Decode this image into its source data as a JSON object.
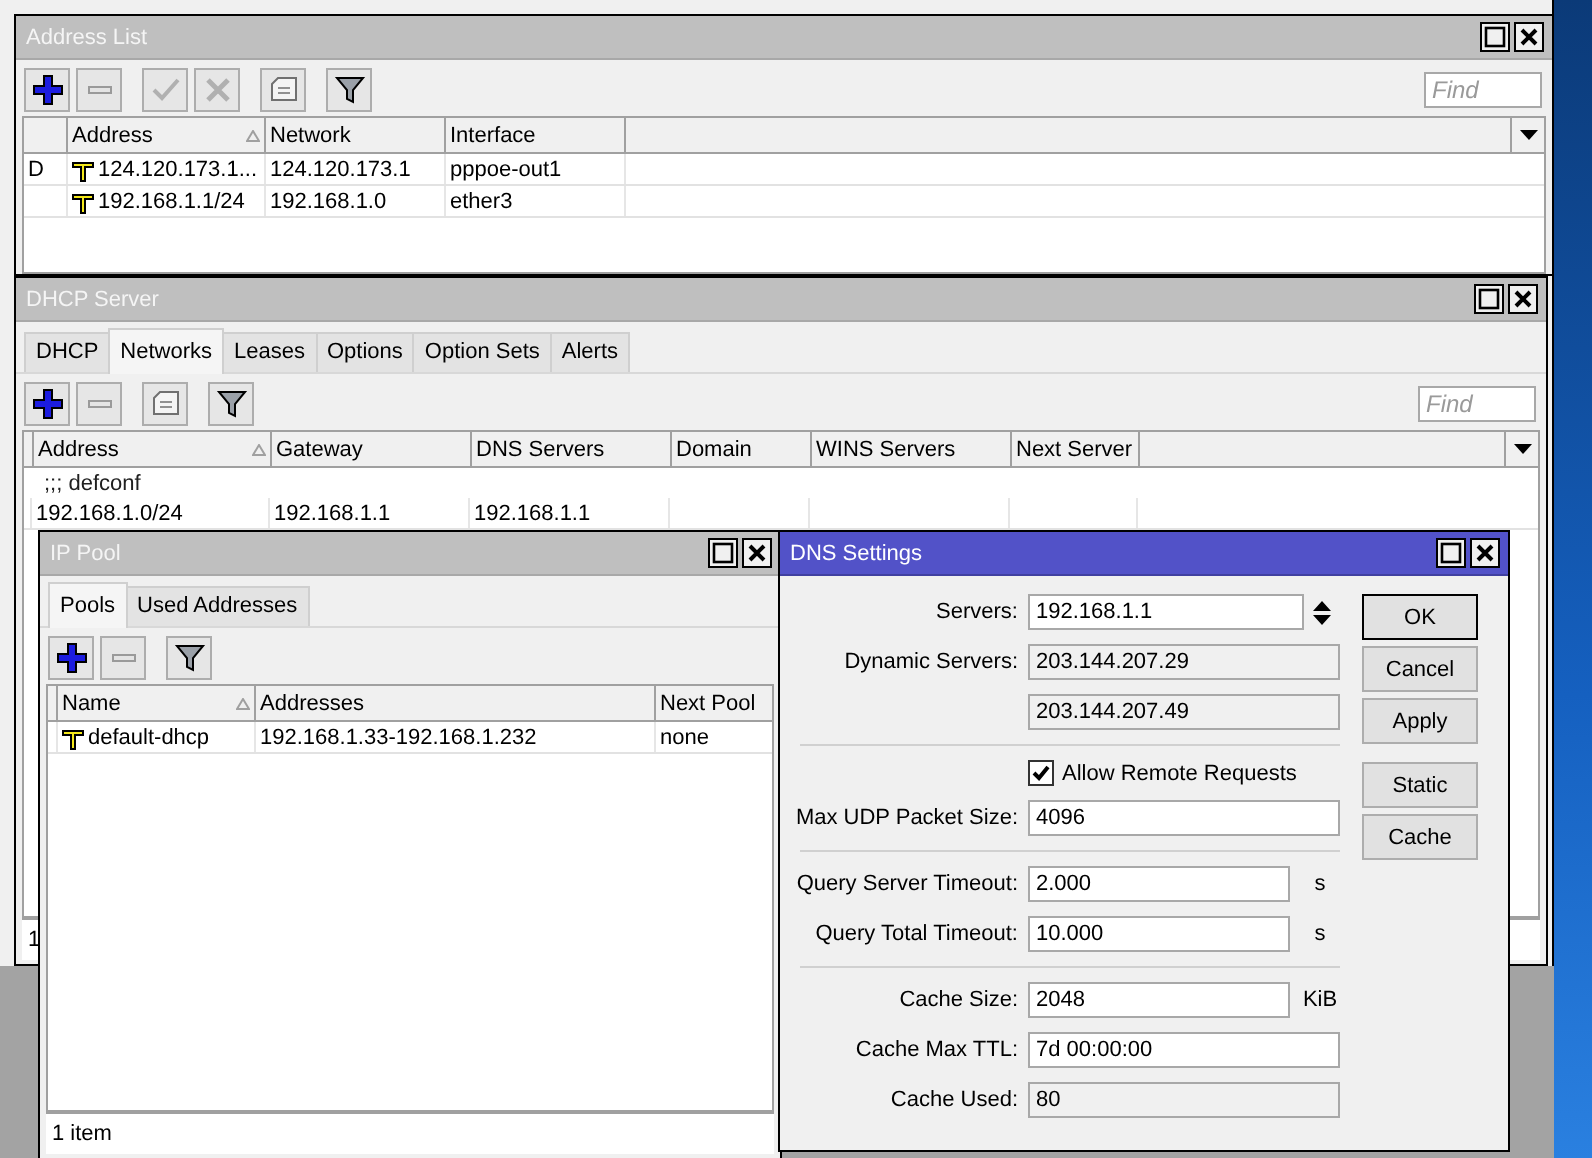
{
  "address_list": {
    "title": "Address List",
    "toolbar": [
      [
        {
          "kind": "add"
        },
        {
          "kind": "remove"
        }
      ],
      [
        {
          "kind": "enable"
        },
        {
          "kind": "disable"
        }
      ],
      [
        {
          "kind": "comment"
        }
      ],
      [
        {
          "kind": "filter"
        }
      ]
    ],
    "find": {
      "placeholder": "Find"
    },
    "columns": [
      {
        "label": "Address",
        "sorted": true
      },
      {
        "label": "Network",
        "sorted": false
      },
      {
        "label": "Interface",
        "sorted": false
      }
    ],
    "rows": [
      {
        "flag": "D",
        "cells": [
          "124.120.173.1...",
          "124.120.173.1",
          "pppoe-out1"
        ]
      },
      {
        "cells": [
          "192.168.1.1/24",
          "192.168.1.0",
          "ether3"
        ]
      }
    ]
  },
  "dhcp_server": {
    "title": "DHCP Server",
    "tabs": [
      {
        "label": "DHCP",
        "selected": false
      },
      {
        "label": "Networks",
        "selected": true
      },
      {
        "label": "Leases",
        "selected": false
      },
      {
        "label": "Options",
        "selected": false
      },
      {
        "label": "Option Sets",
        "selected": false
      },
      {
        "label": "Alerts",
        "selected": false
      }
    ],
    "toolbar": [
      [
        {
          "kind": "add"
        },
        {
          "kind": "remove"
        }
      ],
      [
        {
          "kind": "comment"
        }
      ],
      [
        {
          "kind": "filter"
        }
      ]
    ],
    "find": {
      "placeholder": "Find"
    },
    "columns": [
      {
        "label": "Address",
        "sorted": true
      },
      {
        "label": "Gateway",
        "sorted": false
      },
      {
        "label": "DNS Servers",
        "sorted": false
      },
      {
        "label": "Domain",
        "sorted": false
      },
      {
        "label": "WINS Servers",
        "sorted": false
      },
      {
        "label": "Next Server",
        "sorted": false
      }
    ],
    "rows": [
      {
        "kind": "comment",
        "text": ";;; defconf"
      },
      {
        "kind": "data",
        "cells": [
          "192.168.1.0/24",
          "192.168.1.1",
          "192.168.1.1"
        ]
      }
    ],
    "status": "1"
  },
  "ip_pool": {
    "title": "IP Pool",
    "tabs": [
      {
        "label": "Pools",
        "selected": true
      },
      {
        "label": "Used Addresses",
        "selected": false
      }
    ],
    "toolbar": [
      [
        {
          "kind": "add"
        },
        {
          "kind": "remove"
        }
      ],
      [
        {
          "kind": "filter"
        }
      ]
    ],
    "columns": [
      {
        "label": "Name",
        "sorted": true
      },
      {
        "label": "Addresses",
        "sorted": false
      },
      {
        "label": "Next Pool",
        "sorted": false
      }
    ],
    "rows": [
      {
        "cells": [
          "default-dhcp",
          "192.168.1.33-192.168.1.232",
          "none"
        ]
      }
    ],
    "status": "1 item"
  },
  "dns_settings": {
    "title": "DNS Settings",
    "fields": [
      {
        "kind": "input",
        "label": "Servers:",
        "value": "192.168.1.1",
        "spinner": true
      },
      {
        "kind": "readonly",
        "label": "Dynamic Servers:",
        "value": "203.144.207.29"
      },
      {
        "kind": "readonly",
        "value": "203.144.207.49"
      },
      {
        "kind": "separator"
      },
      {
        "kind": "checkbox",
        "label": "Allow Remote Requests",
        "checked": true
      },
      {
        "kind": "input",
        "label": "Max UDP Packet Size:",
        "value": "4096"
      },
      {
        "kind": "separator"
      },
      {
        "kind": "input",
        "label": "Query Server Timeout:",
        "value": "2.000",
        "unit": "s"
      },
      {
        "kind": "input",
        "label": "Query Total Timeout:",
        "value": "10.000",
        "unit": "s"
      },
      {
        "kind": "separator"
      },
      {
        "kind": "input",
        "label": "Cache Size:",
        "value": "2048",
        "unit": "KiB"
      },
      {
        "kind": "input",
        "label": "Cache Max TTL:",
        "value": "7d 00:00:00"
      },
      {
        "kind": "readonly",
        "label": "Cache Used:",
        "value": "80"
      }
    ],
    "buttons": [
      [
        {
          "label": "OK",
          "default": true
        },
        {
          "label": "Cancel",
          "default": false
        },
        {
          "label": "Apply",
          "default": false
        }
      ],
      [
        {
          "label": "Static",
          "default": false
        },
        {
          "label": "Cache",
          "default": false
        }
      ]
    ]
  }
}
